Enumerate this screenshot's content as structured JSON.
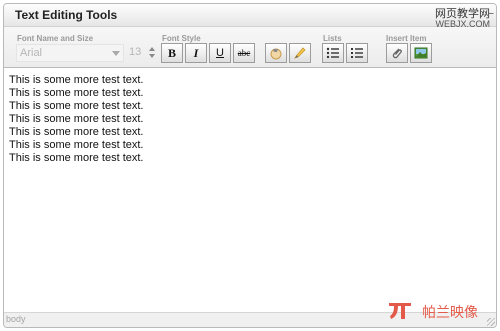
{
  "panel": {
    "title": "Text Editing Tools",
    "collapse_symbol": "−"
  },
  "watermark": {
    "cn": "网页教学网",
    "url": "WEBJX.COM"
  },
  "toolbar": {
    "font_group_label": "Font Name and Size",
    "font_name_value": "Arial",
    "font_size_value": "13",
    "font_style_label": "Font Style",
    "bold_label": "B",
    "italic_label": "I",
    "underline_label": "U",
    "strike_label": "abc",
    "lists_label": "Lists",
    "insert_label": "Insert Item"
  },
  "editor": {
    "lines": [
      "This is some more test text.",
      "This is some more test text.",
      "This is some more test text.",
      "This is some more test text.",
      "This is some more test text.",
      "This is some more test text.",
      "This is some more test text."
    ]
  },
  "status": {
    "element_path": "body"
  },
  "logo": {
    "text": "帕兰映像"
  },
  "colors": {
    "accent": "#e35a4a",
    "toolbar_bg": "#ececec",
    "border": "#b9b9b9"
  }
}
